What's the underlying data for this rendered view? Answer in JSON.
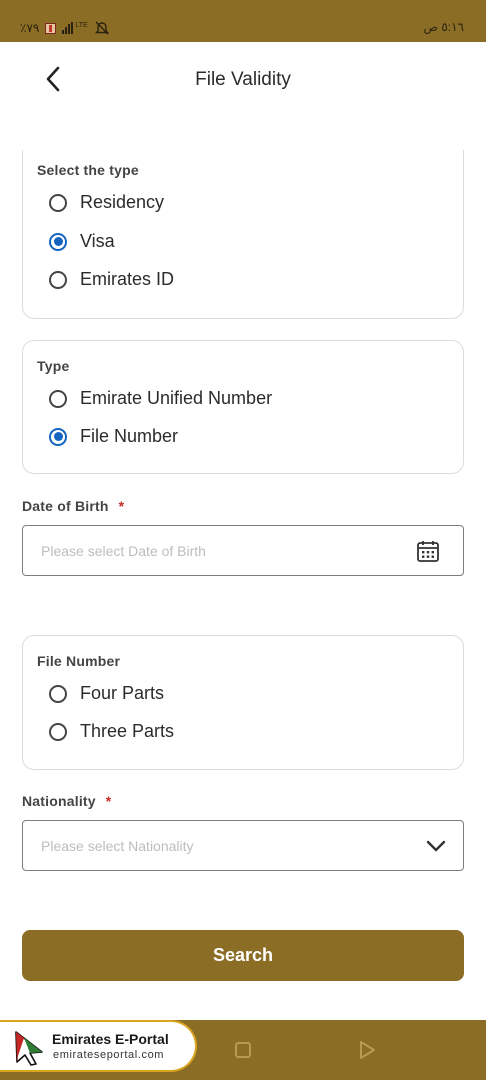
{
  "status_bar": {
    "left_text": "٪٧٩",
    "network_label": "LTE",
    "time": "٥:١٦ ص"
  },
  "app_bar": {
    "title": "File Validity"
  },
  "select_type": {
    "label": "Select the type",
    "options": [
      {
        "label": "Residency",
        "selected": false
      },
      {
        "label": "Visa",
        "selected": true
      },
      {
        "label": "Emirates ID",
        "selected": false
      }
    ]
  },
  "type": {
    "label": "Type",
    "options": [
      {
        "label": "Emirate Unified Number",
        "selected": false
      },
      {
        "label": "File Number",
        "selected": true
      }
    ]
  },
  "date_of_birth": {
    "label": "Date of Birth",
    "required_mark": "*",
    "placeholder": "Please select Date of Birth"
  },
  "file_number": {
    "label": "File Number",
    "options": [
      {
        "label": "Four Parts",
        "selected": false
      },
      {
        "label": "Three Parts",
        "selected": false
      }
    ]
  },
  "nationality": {
    "label": "Nationality",
    "required_mark": "*",
    "placeholder": "Please select Nationality"
  },
  "search_button": {
    "label": "Search"
  },
  "watermark": {
    "title": "Emirates E-Portal",
    "url": "emirateseportal.com"
  },
  "colors": {
    "brand": "#8c6d26",
    "radio_selected": "#1565c0",
    "required": "#c62828",
    "watermark_border": "#d9a420"
  }
}
